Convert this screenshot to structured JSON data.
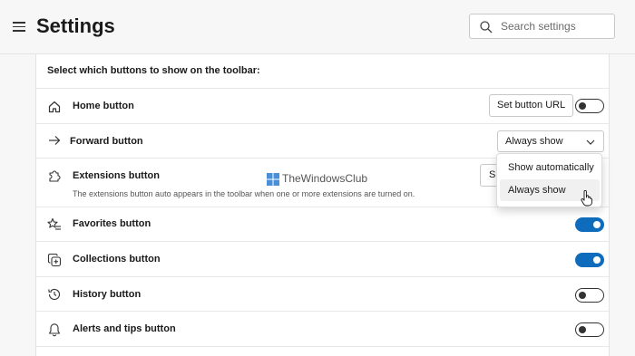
{
  "header": {
    "title": "Settings",
    "search_placeholder": "Search settings"
  },
  "section": {
    "heading": "Select which buttons to show on the toolbar:"
  },
  "rows": [
    {
      "label": "Home button",
      "icon": "home-icon",
      "button": "Set button URL",
      "toggle": "off"
    },
    {
      "label": "Forward button",
      "icon": "arrow-right-icon",
      "select_value": "Always show"
    },
    {
      "label": "Extensions button",
      "icon": "puzzle-icon",
      "description": "The extensions button auto appears in the toolbar when one or more extensions are turned on.",
      "select_value_clipped": "Sh"
    },
    {
      "label": "Favorites button",
      "icon": "star-list-icon",
      "toggle": "on"
    },
    {
      "label": "Collections button",
      "icon": "collections-icon",
      "toggle": "on"
    },
    {
      "label": "History button",
      "icon": "history-icon",
      "toggle": "off"
    },
    {
      "label": "Alerts and tips button",
      "icon": "bell-icon",
      "toggle": "off"
    }
  ],
  "dropdown": {
    "options": [
      "Show automatically",
      "Always show"
    ],
    "selected": "Always show"
  },
  "watermark": {
    "text": "TheWindowsClub"
  },
  "colors": {
    "accent": "#0f6cbd",
    "background": "#f7f7f7",
    "card": "#ffffff"
  }
}
